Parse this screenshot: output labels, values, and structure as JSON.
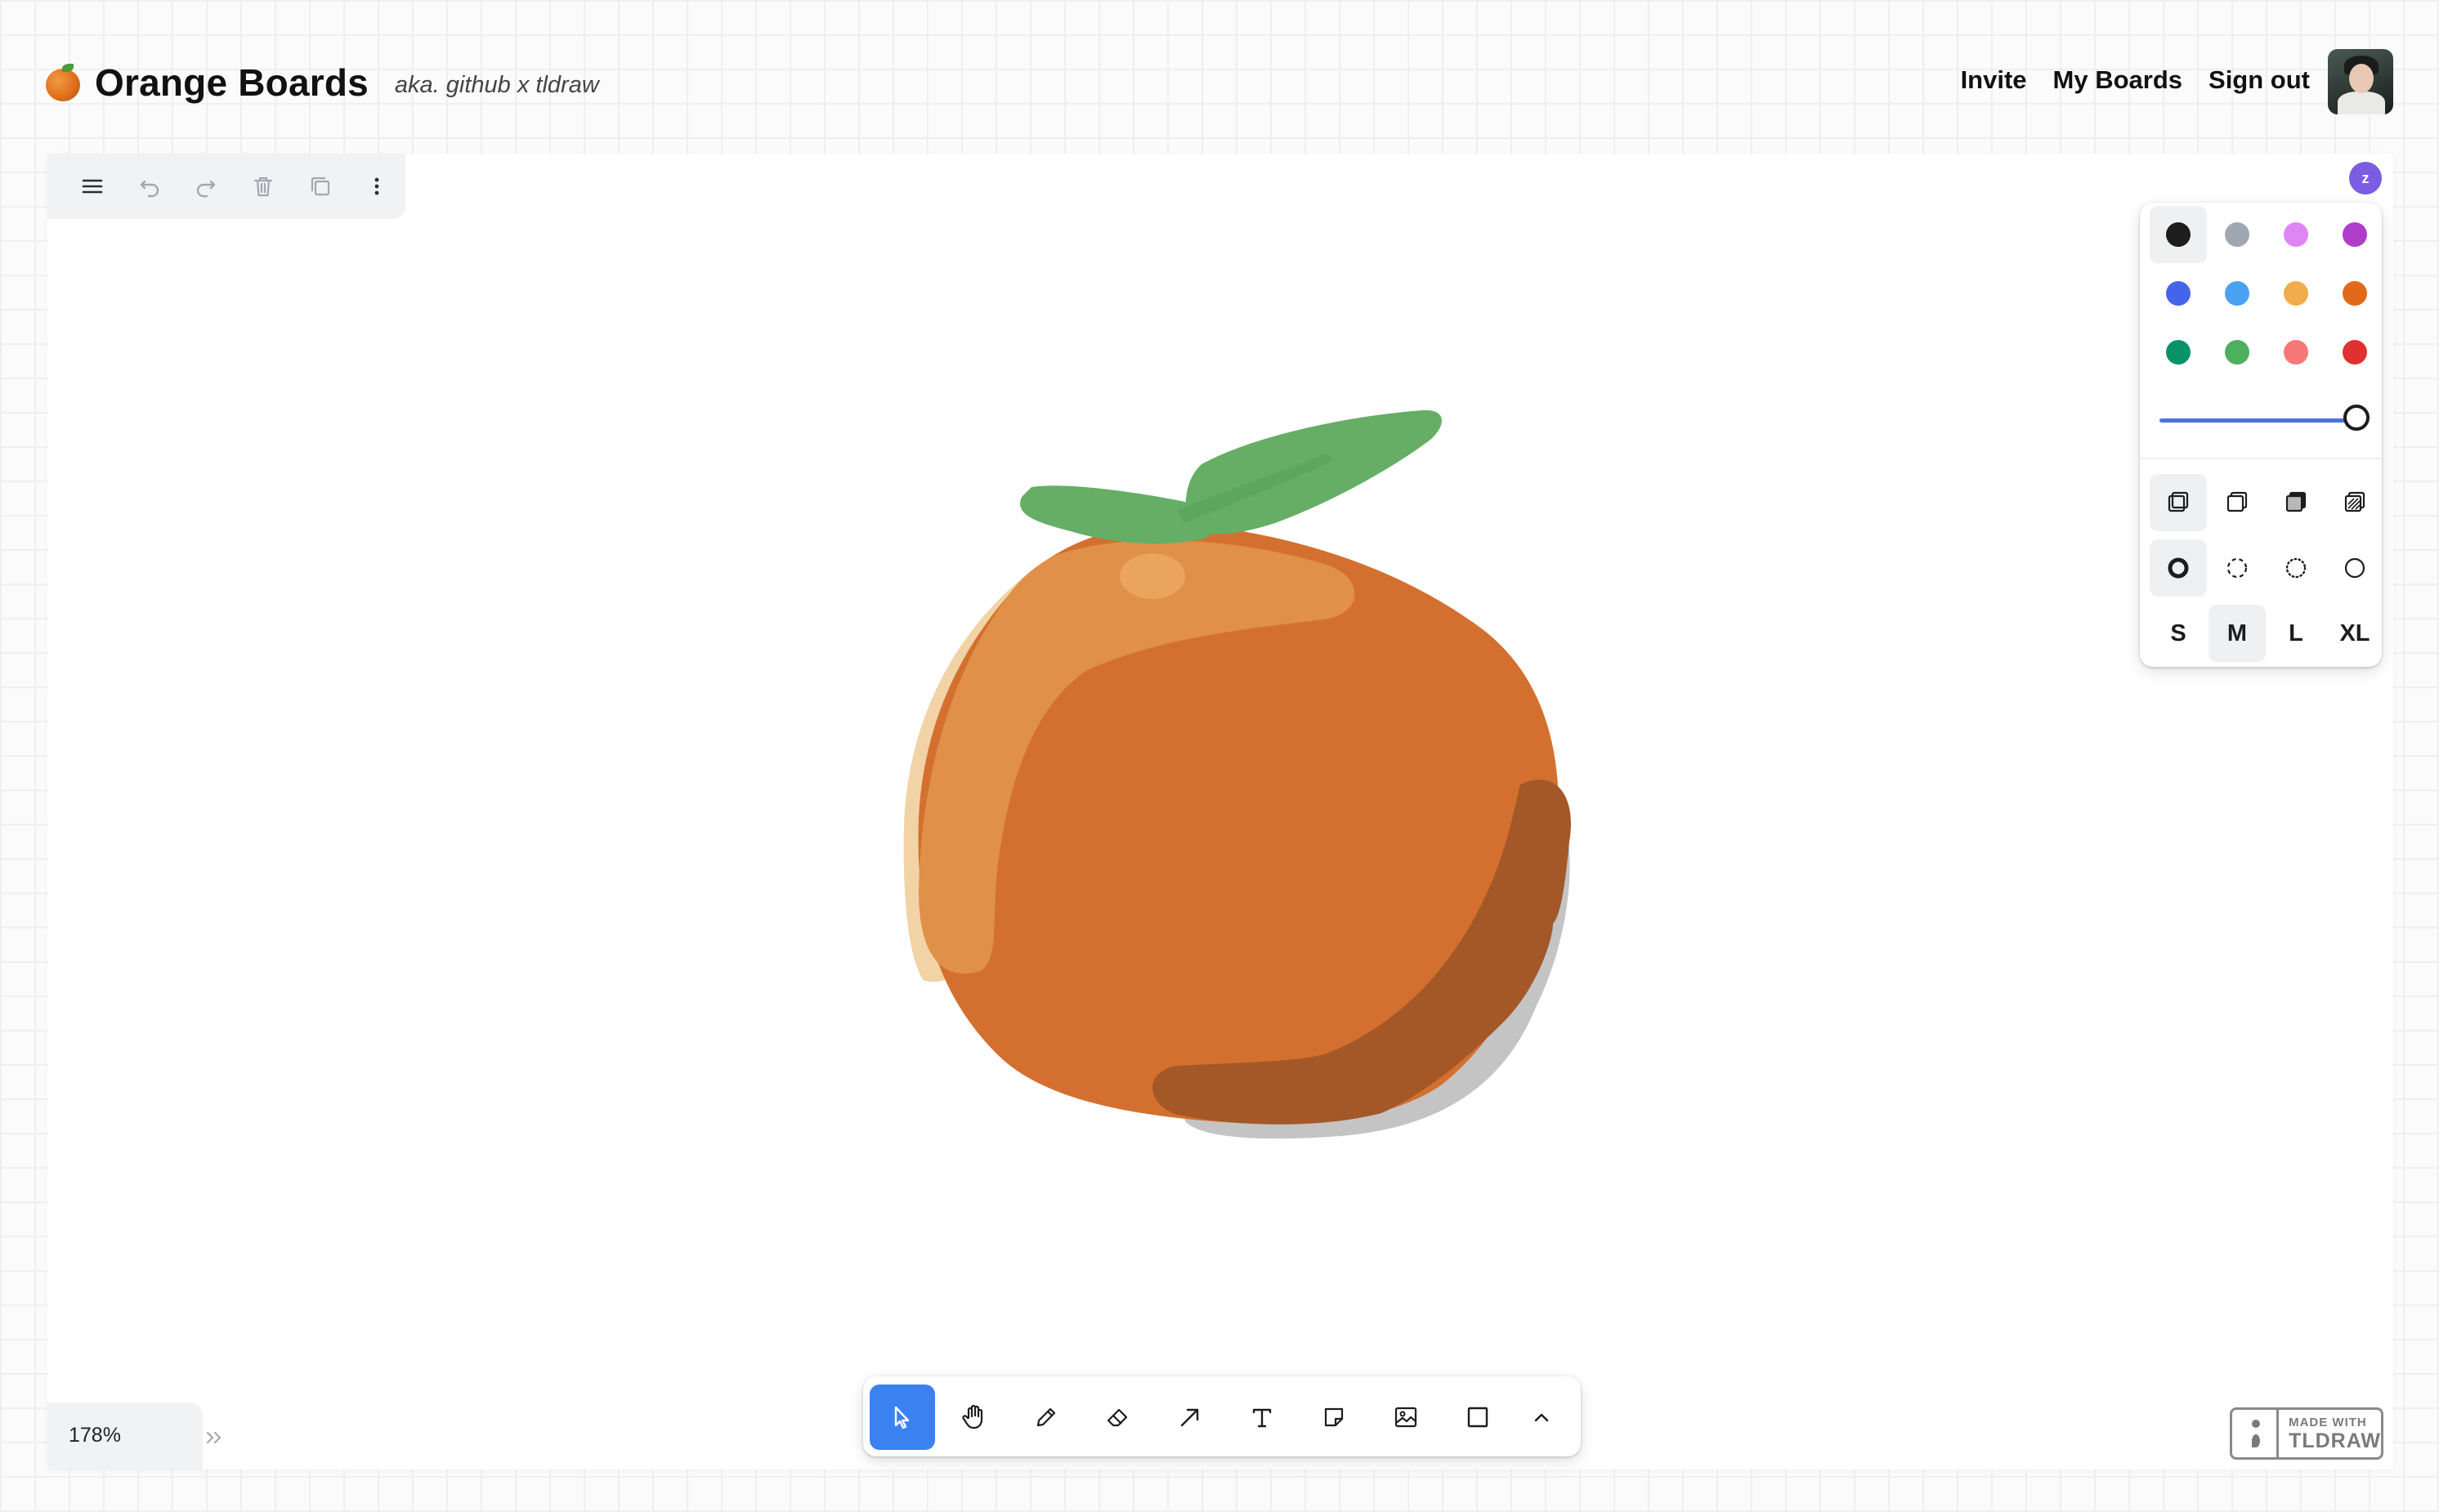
{
  "header": {
    "title": "Orange Boards",
    "subtitle": "aka. github x tldraw",
    "nav": [
      {
        "label": "Invite"
      },
      {
        "label": "My Boards"
      },
      {
        "label": "Sign out"
      }
    ]
  },
  "presence": {
    "initial": "z",
    "color": "#7b5ce2"
  },
  "menu": {
    "icons": [
      "menu-icon",
      "undo-icon",
      "redo-icon",
      "trash-icon",
      "duplicate-icon",
      "more-icon"
    ]
  },
  "style_panel": {
    "colors": [
      {
        "name": "black",
        "hex": "#1d1d1d",
        "selected": true
      },
      {
        "name": "grey",
        "hex": "#9fa8b2"
      },
      {
        "name": "light-violet",
        "hex": "#e085f4"
      },
      {
        "name": "violet",
        "hex": "#ae3ec9"
      },
      {
        "name": "blue",
        "hex": "#4465e9"
      },
      {
        "name": "light-blue",
        "hex": "#4ba1f1"
      },
      {
        "name": "yellow",
        "hex": "#f1ac4b"
      },
      {
        "name": "orange",
        "hex": "#e16919"
      },
      {
        "name": "green",
        "hex": "#099268"
      },
      {
        "name": "light-green",
        "hex": "#4cb05e"
      },
      {
        "name": "light-red",
        "hex": "#f87777"
      },
      {
        "name": "red",
        "hex": "#e03131"
      }
    ],
    "opacity": 1.0,
    "fill_icons": [
      "fill-none-icon",
      "fill-semi-icon",
      "fill-solid-icon",
      "fill-pattern-icon"
    ],
    "dash_icons": [
      "dash-draw-icon",
      "dash-dashed-icon",
      "dash-dotted-icon",
      "dash-solid-icon"
    ],
    "sizes": [
      {
        "label": "S"
      },
      {
        "label": "M",
        "selected": true
      },
      {
        "label": "L"
      },
      {
        "label": "XL"
      }
    ]
  },
  "toolbar": {
    "tools": [
      "select-icon",
      "hand-icon",
      "draw-icon",
      "eraser-icon",
      "arrow-icon",
      "text-icon",
      "note-icon",
      "image-icon",
      "rectangle-icon",
      "chevron-up-icon"
    ],
    "active": "select-icon"
  },
  "zoom": {
    "label": "178%"
  },
  "watermark": {
    "line1": "MADE WITH",
    "line2": "TLDRAW"
  },
  "drawing": {
    "colors": {
      "body": "#d4702f",
      "highlight": "#e09048",
      "peel": "#f2d3a6",
      "shadow": "#a45828",
      "leaf": "#66ae66",
      "cast": "#c4c4c4"
    }
  }
}
